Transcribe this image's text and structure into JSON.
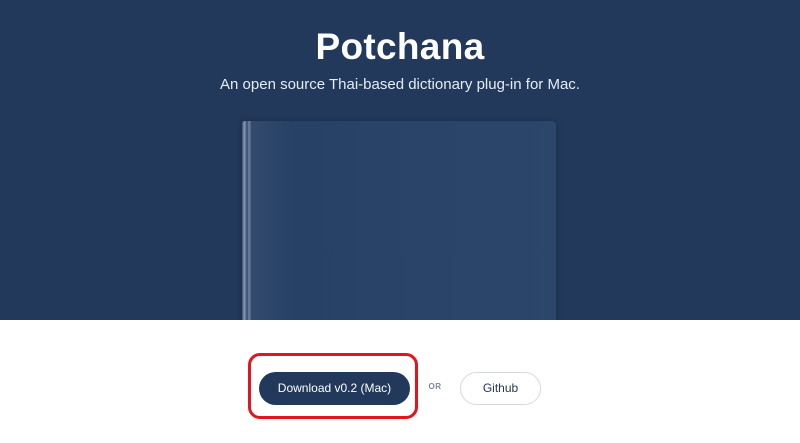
{
  "hero": {
    "title": "Potchana",
    "tagline": "An open source Thai-based dictionary plug-in for Mac."
  },
  "actions": {
    "download_label": "Download v0.2 (Mac)",
    "or_label": "OR",
    "github_label": "Github"
  },
  "colors": {
    "hero_background": "#22395b",
    "primary_button": "#22395b",
    "highlight_outline": "#e3141b"
  }
}
